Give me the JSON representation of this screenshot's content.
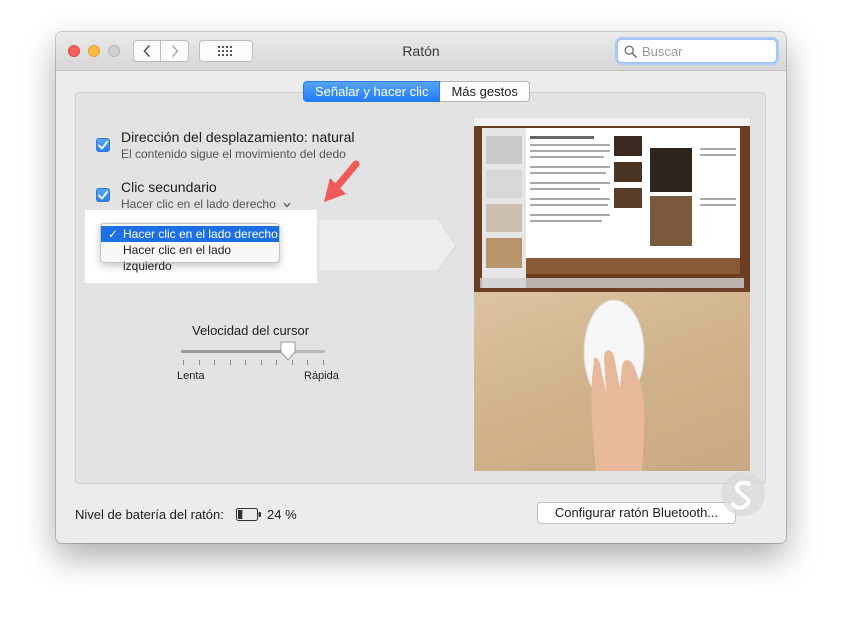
{
  "window": {
    "title": "Ratón"
  },
  "toolbar": {
    "back_icon": "chevron-left-icon",
    "forward_icon": "chevron-right-icon",
    "grid_icon": "grid-icon",
    "search_placeholder": "Buscar"
  },
  "tabs": [
    {
      "label": "Señalar y hacer clic",
      "active": true
    },
    {
      "label": "Más gestos",
      "active": false
    }
  ],
  "options": {
    "scroll": {
      "title": "Dirección del desplazamiento: natural",
      "subtitle": "El contenido sigue el movimiento del dedo",
      "checked": true
    },
    "secondary": {
      "title": "Clic secundario",
      "selected": "Hacer clic en el lado derecho",
      "checked": true
    }
  },
  "dropdown": {
    "items": [
      {
        "label": "Hacer clic en el lado derecho",
        "selected": true
      },
      {
        "label": "Hacer clic en el lado izquierdo",
        "selected": false
      }
    ]
  },
  "speed": {
    "label": "Velocidad del cursor",
    "min_label": "Lenta",
    "max_label": "Rápida",
    "value_fraction": 0.74
  },
  "battery": {
    "label": "Nivel de batería del ratón:",
    "percent": "24 %",
    "level": 0.24
  },
  "bluetooth_button": {
    "label": "Configurar ratón Bluetooth..."
  },
  "colors": {
    "accent": "#1c6fe6",
    "annotation_arrow": "#f05a5a"
  }
}
